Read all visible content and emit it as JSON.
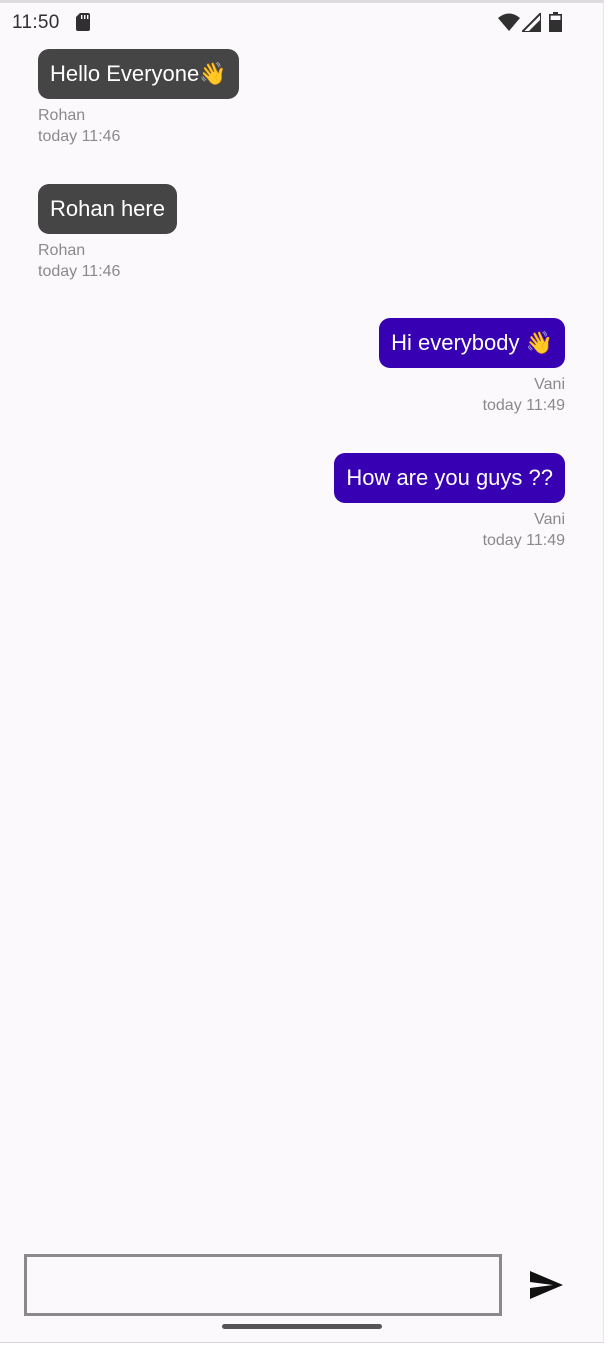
{
  "status_bar": {
    "time": "11:50",
    "icons": [
      "sd-card-icon",
      "wifi-icon",
      "signal-icon",
      "battery-icon"
    ]
  },
  "messages": [
    {
      "text": "Hello Everyone👋",
      "sender": "Rohan",
      "time": "today 11:46",
      "side": "left"
    },
    {
      "text": "Rohan here",
      "sender": "Rohan",
      "time": "today 11:46",
      "side": "left"
    },
    {
      "text": "Hi everybody 👋",
      "sender": "Vani",
      "time": "today 11:49",
      "side": "right"
    },
    {
      "text": "How are you guys ??",
      "sender": "Vani",
      "time": "today 11:49",
      "side": "right"
    }
  ],
  "composer": {
    "value": "",
    "placeholder": ""
  },
  "colors": {
    "incoming_bubble": "#454545",
    "outgoing_bubble": "#3700b3",
    "background": "#fcf9fc",
    "meta_text": "#8a8a8a"
  }
}
